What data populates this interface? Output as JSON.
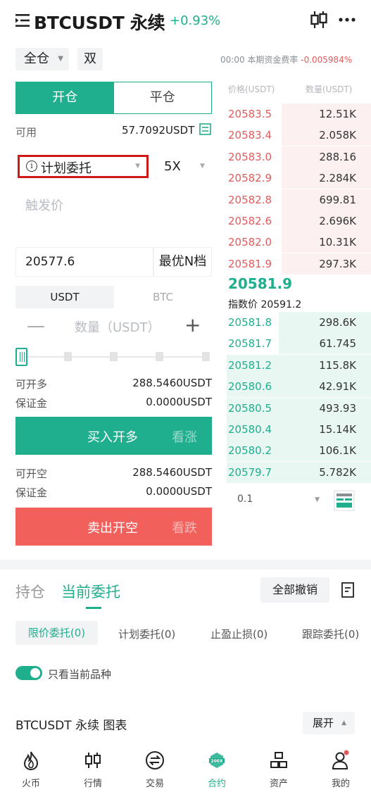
{
  "header": {
    "title": "BTCUSDT 永续",
    "change": "+0.93%"
  },
  "trade_settings": {
    "margin_mode": "全仓",
    "hold_mode": "双",
    "funding_label": "00:00 本期资金费率",
    "funding_rate": "-0.005984%"
  },
  "order_form": {
    "tabs": [
      "开仓",
      "平仓"
    ],
    "available_label": "可用",
    "available_value": "57.7092USDT",
    "order_type": "计划委托",
    "leverage": "5X",
    "trigger_placeholder": "触发价",
    "price": "20577.6",
    "best_n_label": "最优N档",
    "unit_tabs": [
      "USDT",
      "BTC"
    ],
    "quantity_placeholder": "数量（USDT）",
    "slider_percent": 0,
    "buy_open_label": "可开多",
    "buy_open_value": "288.5460USDT",
    "buy_margin_label": "保证金",
    "buy_margin_value": "0.0000USDT",
    "buy_button": "买入开多",
    "buy_button_sub": "看涨",
    "sell_open_label": "可开空",
    "sell_open_value": "288.5460USDT",
    "sell_margin_label": "保证金",
    "sell_margin_value": "0.0000USDT",
    "sell_button": "卖出开空",
    "sell_button_sub": "看跌"
  },
  "orderbook": {
    "price_header": "价格(USDT)",
    "qty_header": "数量(USDT)",
    "asks": [
      {
        "price": "20583.5",
        "qty": "12.51K",
        "depth": 0.62
      },
      {
        "price": "20583.4",
        "qty": "2.058K",
        "depth": 0.62
      },
      {
        "price": "20583.0",
        "qty": "288.16",
        "depth": 0.62
      },
      {
        "price": "20582.9",
        "qty": "2.284K",
        "depth": 0.62
      },
      {
        "price": "20582.8",
        "qty": "699.81",
        "depth": 0.62
      },
      {
        "price": "20582.6",
        "qty": "2.696K",
        "depth": 0.62
      },
      {
        "price": "20582.0",
        "qty": "10.31K",
        "depth": 0.62
      },
      {
        "price": "20581.9",
        "qty": "297.3K",
        "depth": 0.62
      }
    ],
    "last_price": "20581.9",
    "index_price": "指数价 20591.2",
    "bids": [
      {
        "price": "20581.8",
        "qty": "298.6K",
        "depth": 0.64
      },
      {
        "price": "20581.7",
        "qty": "61.745",
        "depth": 0.64
      },
      {
        "price": "20581.2",
        "qty": "115.8K",
        "depth": 1.0
      },
      {
        "price": "20580.6",
        "qty": "42.91K",
        "depth": 1.0
      },
      {
        "price": "20580.5",
        "qty": "493.93",
        "depth": 1.0
      },
      {
        "price": "20580.4",
        "qty": "15.14K",
        "depth": 1.0
      },
      {
        "price": "20580.2",
        "qty": "106.1K",
        "depth": 1.0
      },
      {
        "price": "20579.7",
        "qty": "5.782K",
        "depth": 1.0
      }
    ],
    "depth_step": "0.1"
  },
  "orders_panel": {
    "tabs": [
      "持仓",
      "当前委托"
    ],
    "cancel_all": "全部撤销",
    "subtabs": [
      "限价委托(0)",
      "计划委托(0)",
      "止盈止损(0)",
      "跟踪委托(0)"
    ],
    "only_current_label": "只看当前品种",
    "chart_row_label": "BTCUSDT 永续 图表",
    "expand_label": "展开"
  },
  "bottom_nav": [
    {
      "label": "火币",
      "icon": "flame-icon"
    },
    {
      "label": "行情",
      "icon": "candlestick-icon"
    },
    {
      "label": "交易",
      "icon": "exchange-icon"
    },
    {
      "label": "合约",
      "icon": "contract-icon"
    },
    {
      "label": "资产",
      "icon": "assets-icon"
    },
    {
      "label": "我的",
      "icon": "profile-icon"
    }
  ],
  "colors": {
    "accent": "#1fae8e",
    "sell": "#f2605c",
    "highlight": "#d01818"
  }
}
